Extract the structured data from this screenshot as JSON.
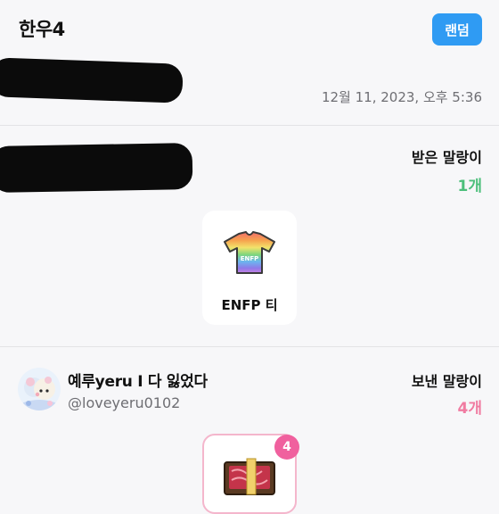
{
  "header": {
    "title": "한우4",
    "random_button": "랜덤"
  },
  "timestamp": "12월 11, 2023, 오후 5:36",
  "received": {
    "label": "받은 말랑이",
    "count": "1개",
    "items": [
      {
        "name": "ENFP 티",
        "icon": "tshirt-icon"
      }
    ]
  },
  "sender": {
    "name": "예루yeru I 다 잃었다",
    "handle": "@loveyeru0102"
  },
  "sent": {
    "label": "보낸 말랑이",
    "count": "4개",
    "items": [
      {
        "icon": "hanwoo-gift-box-icon",
        "quantity": "4"
      }
    ]
  },
  "colors": {
    "accent": "#2f9bf3",
    "received_count": "#4cbf7b",
    "sent_count": "#f07ba1",
    "badge": "#f0609e"
  }
}
